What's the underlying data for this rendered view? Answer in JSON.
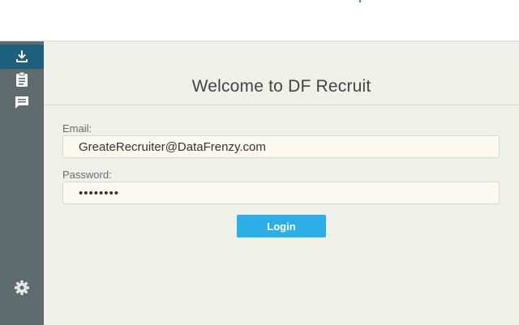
{
  "header": {
    "title": "Welcome to DF Recruit"
  },
  "sidebar": {
    "items": [
      {
        "icon": "download-icon",
        "active": true
      },
      {
        "icon": "clipboard-icon",
        "active": false
      },
      {
        "icon": "message-icon",
        "active": false
      }
    ],
    "bottom": {
      "icon": "gear-icon"
    }
  },
  "form": {
    "email_label": "Email:",
    "email_value": "GreateRecruiter@DataFrenzy.com",
    "password_label": "Password:",
    "password_value": "••••••••",
    "login_label": "Login"
  },
  "colors": {
    "sidebar": "#5e6c70",
    "sidebar_active": "#1f5f7e",
    "background": "#eef0e9",
    "input_bg": "#fbfaf1",
    "button": "#2eaee6"
  }
}
